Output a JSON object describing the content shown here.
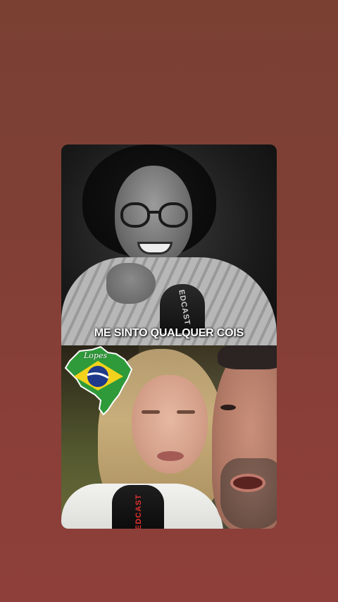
{
  "caption": {
    "text": "ME SINTO QUALQUER COIS"
  },
  "sticker": {
    "label": "Lopes"
  },
  "microphones": {
    "top_label": "EDCAST",
    "bottom_label": "EDCAST"
  },
  "colors": {
    "background": "#7f3f34",
    "caption_text": "#ffffff",
    "brazil_green": "#2f9a3a",
    "brazil_yellow": "#f3d21b",
    "brazil_blue": "#1f3a8a"
  }
}
